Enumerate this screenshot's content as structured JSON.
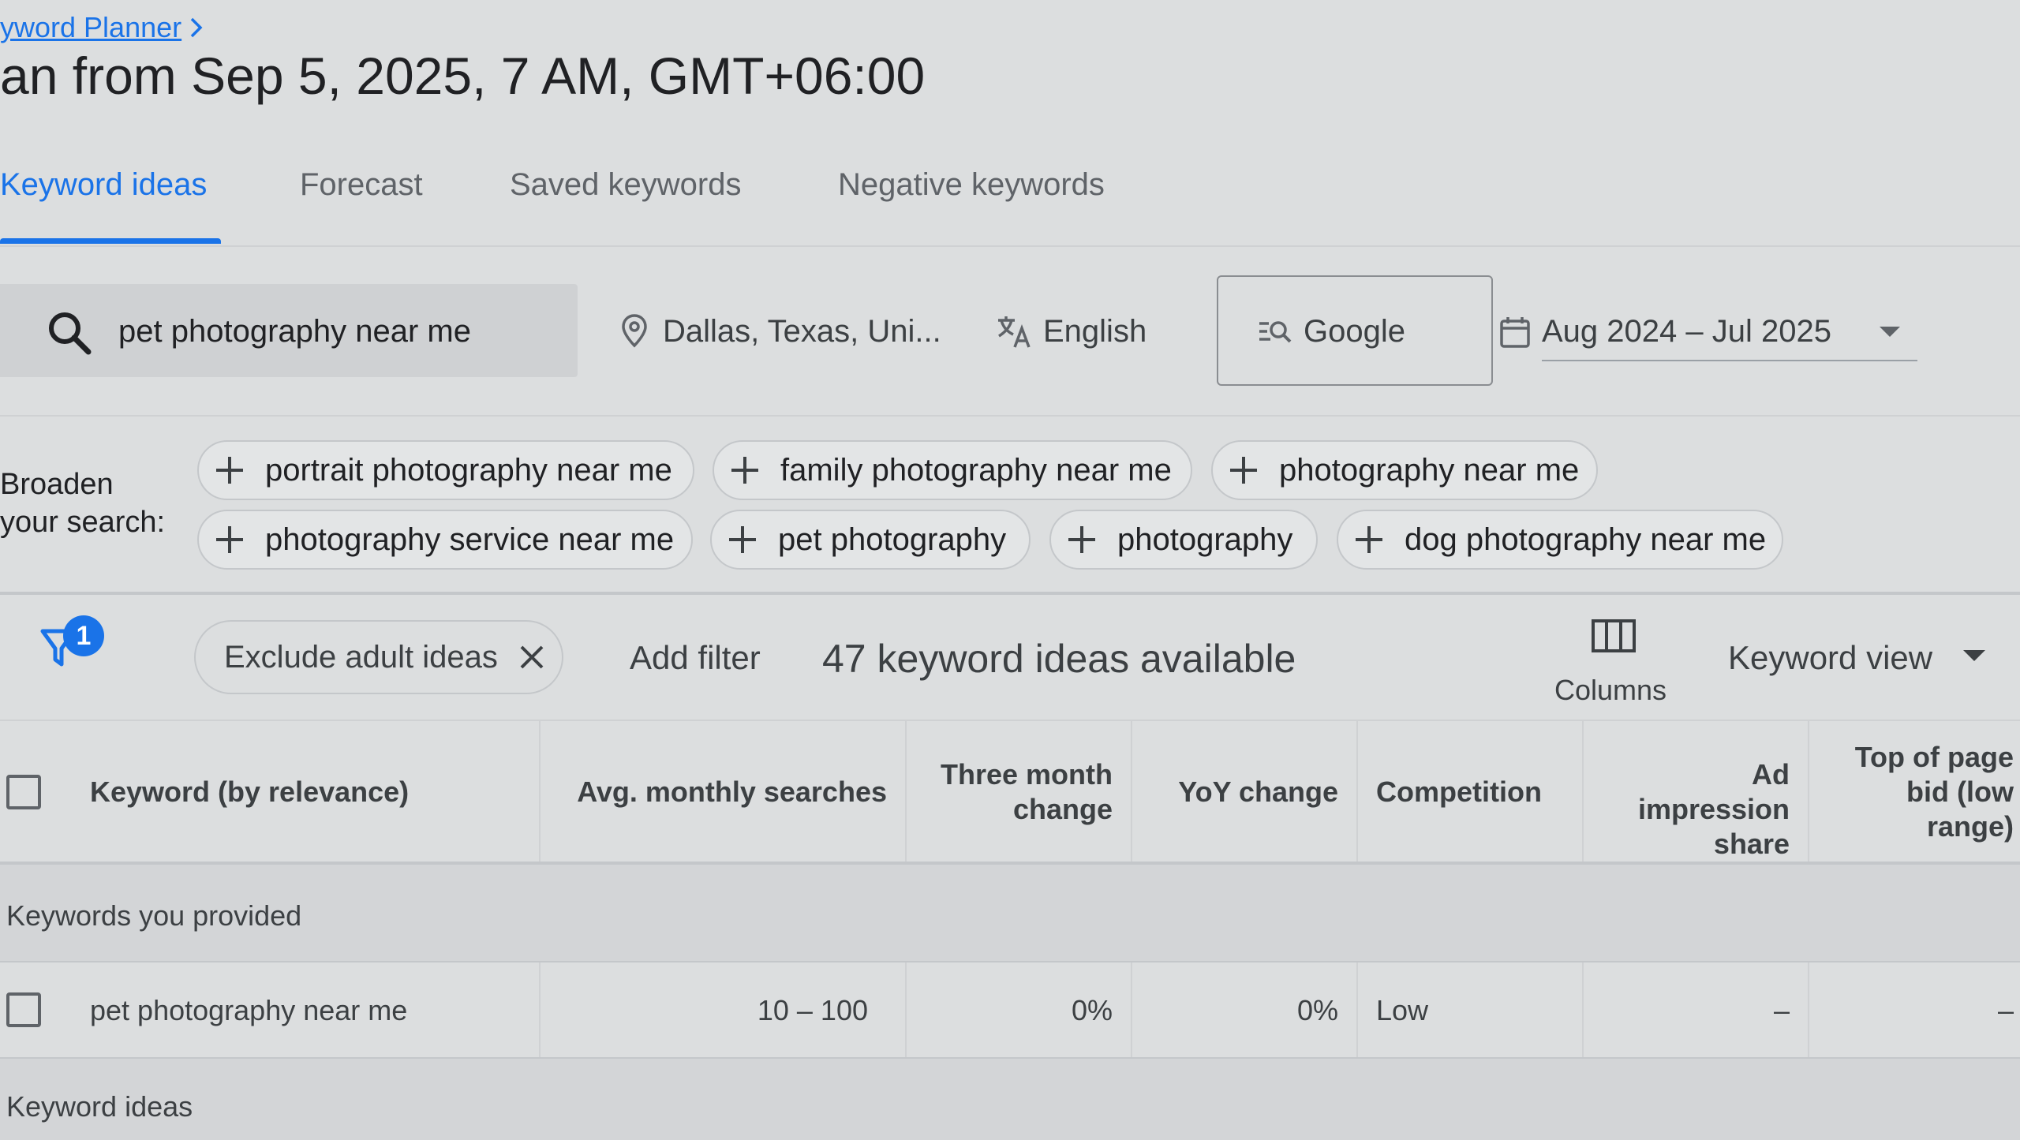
{
  "breadcrumb": {
    "link": "yword Planner",
    "chevron": "›"
  },
  "page": {
    "title": "an from Sep 5, 2025, 7 AM, GMT+06:00"
  },
  "tabs": [
    {
      "label": "Keyword ideas",
      "active": true
    },
    {
      "label": "Forecast"
    },
    {
      "label": "Saved keywords"
    },
    {
      "label": "Negative keywords"
    }
  ],
  "search": {
    "query": "pet photography near me",
    "icon": "search-icon"
  },
  "targeting": {
    "location": "Dallas, Texas, Uni...",
    "language": "English",
    "network": "Google",
    "date_range": "Aug 2024 – Jul 2025"
  },
  "broaden": {
    "label": "Broaden your search:",
    "chips": [
      "portrait photography near me",
      "family photography near me",
      "photography near me",
      "photography service near me",
      "pet photography",
      "photography",
      "dog photography near me"
    ]
  },
  "filters": {
    "badge_count": "1",
    "active_filter": "Exclude adult ideas",
    "add_filter": "Add filter",
    "count_text": "47 keyword ideas available",
    "columns_label": "Columns",
    "view_label": "Keyword view"
  },
  "table": {
    "headers": {
      "keyword": "Keyword (by relevance)",
      "avg_monthly": "Avg. monthly searches",
      "three_month": "Three month change",
      "yoy": "YoY change",
      "competition": "Competition",
      "ad_impression": "Ad impression share",
      "top_bid_low": "Top of page bid (low range)"
    },
    "group_provided": "Keywords you provided",
    "rows": [
      {
        "keyword": "pet photography near me",
        "avg_monthly": "10 – 100",
        "three_month": "0%",
        "yoy": "0%",
        "competition": "Low",
        "ad_impression": "–",
        "top_bid_low": "–"
      }
    ],
    "group_ideas": "Keyword ideas"
  },
  "colors": {
    "accent": "#1a73e8",
    "background": "#dcdedf",
    "text": "#3c4043"
  }
}
